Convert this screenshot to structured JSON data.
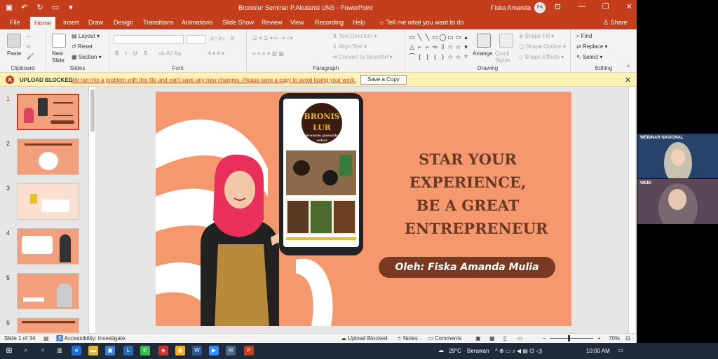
{
  "titlebar": {
    "document_title": "Bronislur Seminar P.Akutansi UNS  -  PowerPoint",
    "user_name": "Fiska Amanda",
    "user_initials": "FA"
  },
  "tabs": [
    "File",
    "Home",
    "Insert",
    "Draw",
    "Design",
    "Transitions",
    "Animations",
    "Slide Show",
    "Review",
    "View",
    "Recording",
    "Help"
  ],
  "tell_me": "Tell me what you want to do",
  "share": "Share",
  "ribbon": {
    "clipboard": {
      "label": "Clipboard",
      "paste": "Paste"
    },
    "slides": {
      "label": "Slides",
      "new_slide": "New Slide",
      "layout": "Layout",
      "reset": "Reset",
      "section": "Section"
    },
    "font": {
      "label": "Font"
    },
    "paragraph": {
      "label": "Paragraph",
      "text_direction": "Text Direction",
      "align_text": "Align Text",
      "convert_smartart": "Convert to SmartArt"
    },
    "drawing": {
      "label": "Drawing",
      "arrange": "Arrange",
      "quick_styles": "Quick Styles",
      "shape_fill": "Shape Fill",
      "shape_outline": "Shape Outline",
      "shape_effects": "Shape Effects"
    },
    "editing": {
      "label": "Editing",
      "find": "Find",
      "replace": "Replace",
      "select": "Select"
    }
  },
  "message_bar": {
    "title": "UPLOAD BLOCKED",
    "text": "We ran into a problem with this file and can't save any new changes. Please save a copy to avoid losing your work.",
    "button": "Save a Copy"
  },
  "slide_numbers": [
    "1",
    "2",
    "3",
    "4",
    "5",
    "6"
  ],
  "slide": {
    "logo_line1": "BRONIS",
    "logo_line2": "LUR",
    "logo_sub": "brownis gawanis sehat",
    "headline_1": "STAR YOUR",
    "headline_2": "EXPERIENCE,",
    "headline_3": "BE A GREAT",
    "headline_4": "ENTREPRENEUR",
    "byline": "Oleh: Fiska Amanda Mulia"
  },
  "statusbar": {
    "slide_of": "Slide 1 of 34",
    "accessibility": "Accessibility: Investigate",
    "upload_blocked": "Upload Blocked",
    "notes": "Notes",
    "comments": "Comments",
    "zoom": "70%"
  },
  "taskbar": {
    "temperature": "29°C",
    "weather": "Berawan",
    "time": "10:00 AM"
  },
  "webcam": {
    "banner": "WEBINAR NASIONAL",
    "banner_short": "WEBI"
  },
  "colors": {
    "accent": "#c43e1c",
    "slide_bg": "#f6986e",
    "headline": "#6a3a25",
    "byline_bg": "#7a3a22"
  }
}
